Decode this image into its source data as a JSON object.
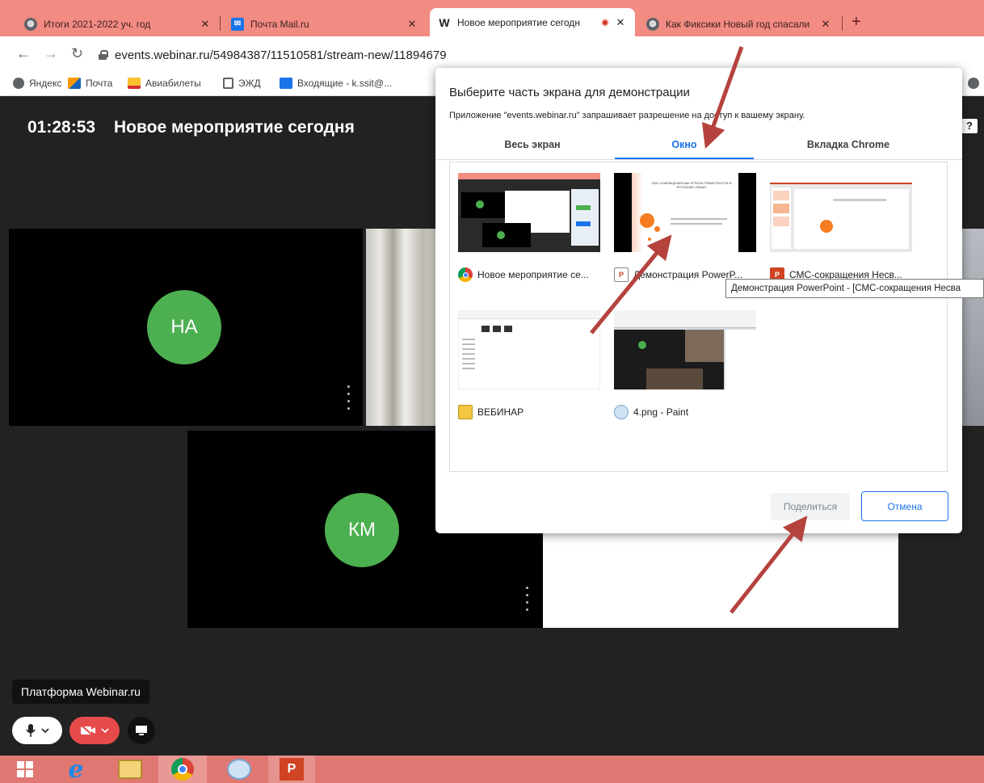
{
  "browser": {
    "tabs": [
      {
        "title": "Итоги 2021-2022 уч. год",
        "favicon": "globe-icon"
      },
      {
        "title": "Почта Mail.ru",
        "favicon": "mail-icon"
      },
      {
        "title": "Новое мероприятие сегодн",
        "favicon": "webinar-w-icon"
      },
      {
        "title": "Как Фиксики Новый год спасали",
        "favicon": "globe-icon"
      }
    ],
    "favicon_letter_w": "W",
    "close_glyph": "✕",
    "new_tab_glyph": "+",
    "url": "events.webinar.ru/54984387/11510581/stream-new/11894679",
    "bookmarks": [
      {
        "label": "Яндекс",
        "icon": "globe-icon"
      },
      {
        "label": "Почта",
        "icon": "mail-envelope-icon"
      },
      {
        "label": "Авиабилеты",
        "icon": "bag-icon"
      },
      {
        "label": "ЭЖД",
        "icon": "document-icon"
      },
      {
        "label": "Входящие - k.ssit@...",
        "icon": "mail-icon"
      }
    ]
  },
  "webinar": {
    "timer": "01:28:53",
    "event_title": "Новое мероприятие сегодня",
    "help_label": "?",
    "participants": [
      {
        "initials": "НА"
      },
      {
        "initials": "КМ"
      }
    ],
    "platform_label": "Платформа Webinar.ru"
  },
  "share_dialog": {
    "title": "Выберите часть экрана для демонстрации",
    "subtitle": "Приложение \"events.webinar.ru\" запрашивает разрешение на доступ к вашему экрану.",
    "tabs": [
      "Весь экран",
      "Окно",
      "Вкладка Chrome"
    ],
    "active_tab": "Окно",
    "windows": [
      {
        "label": "Новое мероприятие се...",
        "icon": "chrome-icon"
      },
      {
        "label": "Демонстрация PowerP...",
        "icon": "powerpoint-icon"
      },
      {
        "label": "СМС-сокращения Несв...",
        "icon": "powerpoint-icon"
      },
      {
        "label": "ВЕБИНАР",
        "icon": "folder-icon"
      },
      {
        "label": "4.png - Paint",
        "icon": "paint-icon"
      }
    ],
    "tooltip": "Демонстрация PowerPoint - [СМС-сокращения Несва",
    "slide_title": "СМС-СОКРАЩЕНИЯ КАК УГРОЗА ГРАМОТНОСТИ И РУССКОМУ ЯЗЫКУ",
    "share_button": "Поделиться",
    "cancel_button": "Отмена"
  },
  "colors": {
    "tab_strip": "#f28b82",
    "accent": "#1a73e8",
    "avatar": "#4caf50",
    "annotation_arrow": "#b5423d"
  }
}
